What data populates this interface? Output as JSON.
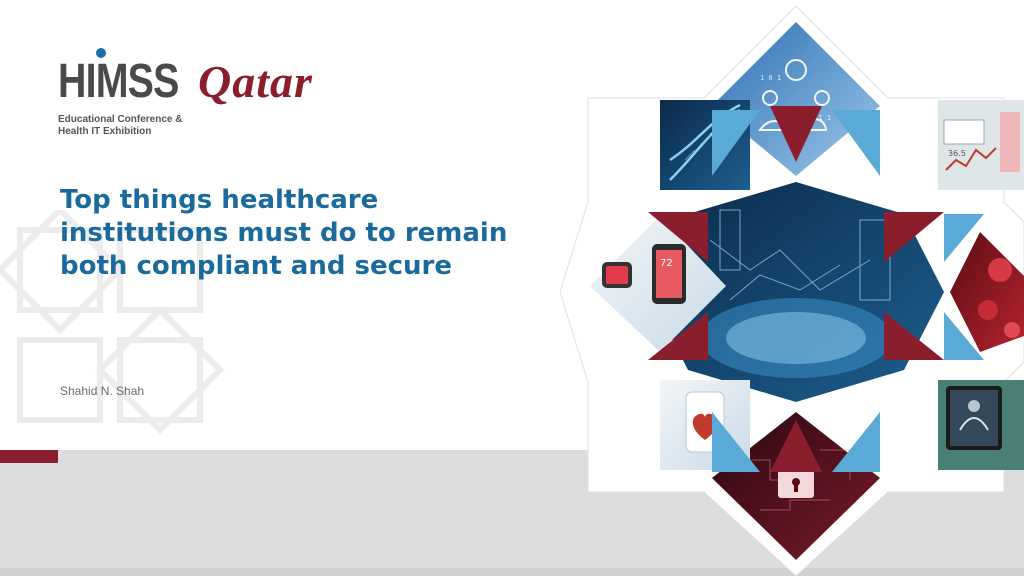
{
  "logo": {
    "brand": "HIMSS",
    "region": "Qatar",
    "tagline_line1": "Educational Conference &",
    "tagline_line2": "Health IT Exhibition"
  },
  "title": "Top things healthcare institutions must do to remain both compliant and secure",
  "author": "Shahid N. Shah",
  "colors": {
    "title_blue": "#1b6a9c",
    "brand_maroon": "#8b1e2d",
    "sky_blue": "#5aaad8",
    "gray_band": "#dcdcde"
  },
  "mosaic": {
    "tiles": [
      {
        "id": "cloud-gears",
        "icon": "cloud-gears-icon"
      },
      {
        "id": "dna",
        "icon": "dna-icon"
      },
      {
        "id": "health-dashboard",
        "icon": "dashboard-icon"
      },
      {
        "id": "smartwatch",
        "icon": "smartwatch-icon"
      },
      {
        "id": "globe-network",
        "icon": "globe-network-icon"
      },
      {
        "id": "blood-cells",
        "icon": "blood-cells-icon"
      },
      {
        "id": "doctor-heart",
        "icon": "heart-icon"
      },
      {
        "id": "tablet-xray",
        "icon": "xray-tablet-icon"
      },
      {
        "id": "padlock",
        "icon": "padlock-icon"
      }
    ]
  }
}
